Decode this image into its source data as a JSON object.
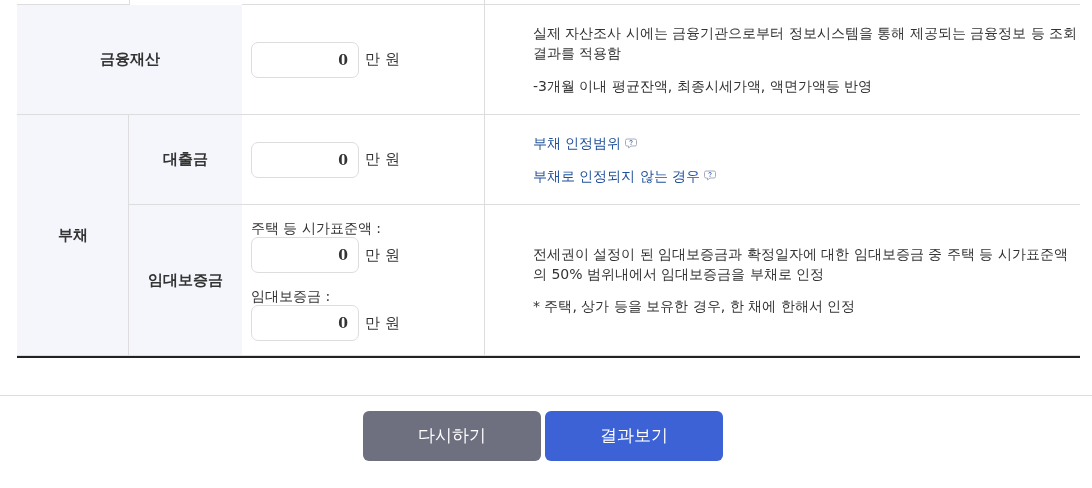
{
  "financial": {
    "label": "금융재산",
    "inputs": [
      {
        "value": "0",
        "unit": "만 원"
      }
    ],
    "notes": [
      {
        "kind": "text",
        "text": "실제 자산조사 시에는 금융기관으로부터 정보시스템을 통해 제공되는 금융정보 등 조회결과를 적용함"
      },
      {
        "kind": "text",
        "text": "-3개월 이내 평균잔액, 최종시세가액, 액면가액등 반영"
      }
    ]
  },
  "debt": {
    "label": "부채",
    "items": [
      {
        "label": "대출금",
        "inputs": [
          {
            "value": "0",
            "unit": "만 원"
          }
        ],
        "notes": [
          {
            "kind": "link",
            "text": "부채 인정범위"
          },
          {
            "kind": "link",
            "text": "부채로 인정되지 않는 경우"
          }
        ]
      },
      {
        "label": "임대보증금",
        "inputs": [
          {
            "label": "주택 등 시가표준액 :",
            "value": "0",
            "unit": "만 원"
          },
          {
            "label": "임대보증금 :",
            "value": "0",
            "unit": "만 원"
          }
        ],
        "notes": [
          {
            "kind": "text",
            "text": "전세권이 설정이 된 임대보증금과 확정일자에 대한 임대보증금 중 주택 등 시가표준액의 50% 범위내에서 임대보증금을 부채로 인정"
          },
          {
            "kind": "text",
            "text": "* 주택, 상가 등을 보유한 경우, 한 채에 한해서 인정"
          }
        ]
      }
    ]
  },
  "buttons": [
    {
      "label": "다시하기",
      "kind": "secondary"
    },
    {
      "label": "결과보기",
      "kind": "primary"
    }
  ]
}
